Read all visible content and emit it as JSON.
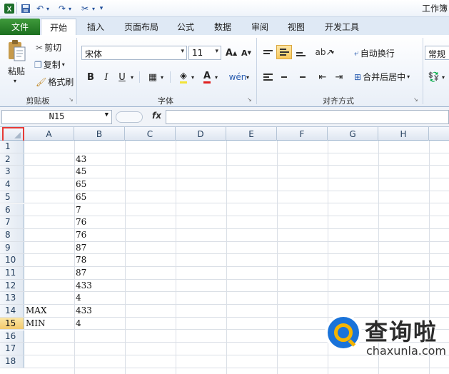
{
  "window": {
    "title": "工作簿"
  },
  "tabs": [
    {
      "label": "文件"
    },
    {
      "label": "开始"
    },
    {
      "label": "插入"
    },
    {
      "label": "页面布局"
    },
    {
      "label": "公式"
    },
    {
      "label": "数据"
    },
    {
      "label": "审阅"
    },
    {
      "label": "视图"
    },
    {
      "label": "开发工具"
    }
  ],
  "clipboard": {
    "paste": "粘贴",
    "cut": "剪切",
    "copy": "复制",
    "format_painter": "格式刷",
    "group": "剪贴板"
  },
  "font": {
    "name": "宋体",
    "size": "11",
    "bold": "B",
    "italic": "I",
    "underline": "U",
    "group": "字体"
  },
  "alignment": {
    "wrap": "自动换行",
    "merge": "合并后居中",
    "group": "对齐方式"
  },
  "number": {
    "format": "常规"
  },
  "formula_bar": {
    "name_box": "N15",
    "fx": "fx",
    "formula": ""
  },
  "columns": [
    "A",
    "B",
    "C",
    "D",
    "E",
    "F",
    "G",
    "H"
  ],
  "rows": [
    {
      "n": "1",
      "a": "",
      "b": ""
    },
    {
      "n": "2",
      "a": "",
      "b": "43"
    },
    {
      "n": "3",
      "a": "",
      "b": "45"
    },
    {
      "n": "4",
      "a": "",
      "b": "65"
    },
    {
      "n": "5",
      "a": "",
      "b": "65"
    },
    {
      "n": "6",
      "a": "",
      "b": "7"
    },
    {
      "n": "7",
      "a": "",
      "b": "76"
    },
    {
      "n": "8",
      "a": "",
      "b": "76"
    },
    {
      "n": "9",
      "a": "",
      "b": "87"
    },
    {
      "n": "10",
      "a": "",
      "b": "78"
    },
    {
      "n": "11",
      "a": "",
      "b": "87"
    },
    {
      "n": "12",
      "a": "",
      "b": "433"
    },
    {
      "n": "13",
      "a": "",
      "b": "4"
    },
    {
      "n": "14",
      "a": "MAX",
      "b": "433"
    },
    {
      "n": "15",
      "a": "MIN",
      "b": "4"
    },
    {
      "n": "16",
      "a": "",
      "b": ""
    },
    {
      "n": "17",
      "a": "",
      "b": ""
    },
    {
      "n": "18",
      "a": "",
      "b": ""
    }
  ],
  "selected_row": "15",
  "watermark": {
    "name": "查询啦",
    "url": "chaxunla.com"
  },
  "colors": {
    "file_tab": "#2a7f2c",
    "highlight": "#e63a36",
    "brand_blue": "#1a73d9",
    "brand_yellow": "#f4b400"
  }
}
